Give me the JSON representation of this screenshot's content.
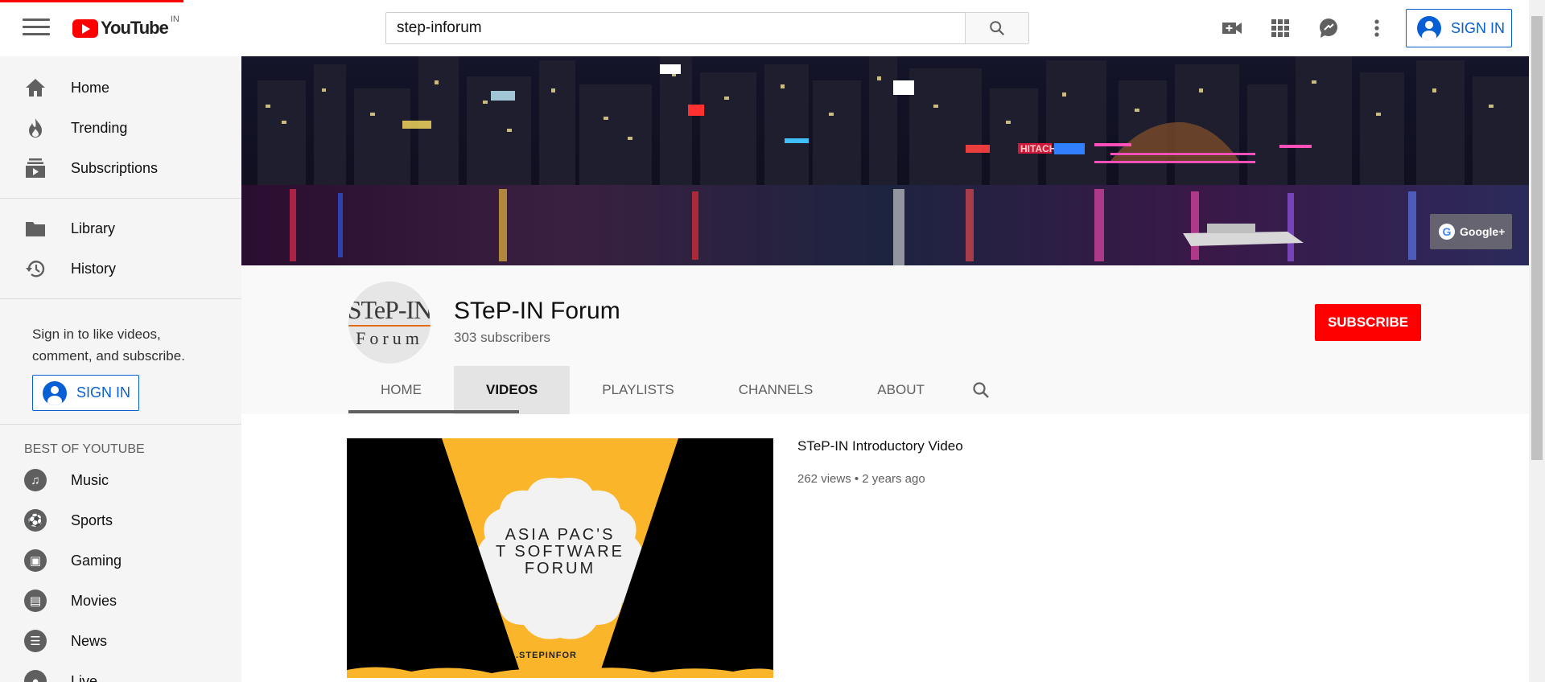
{
  "header": {
    "logo_text": "YouTube",
    "logo_country": "IN",
    "search_value": "step-inforum",
    "signin_label": "SIGN IN"
  },
  "sidebar": {
    "main": [
      {
        "label": "Home",
        "icon": "home-icon"
      },
      {
        "label": "Trending",
        "icon": "flame-icon"
      },
      {
        "label": "Subscriptions",
        "icon": "subscriptions-icon"
      }
    ],
    "library": [
      {
        "label": "Library",
        "icon": "folder-icon"
      },
      {
        "label": "History",
        "icon": "history-icon"
      }
    ],
    "signin_text": "Sign in to like videos, comment, and subscribe.",
    "signin_label": "SIGN IN",
    "best_of_title": "BEST OF YOUTUBE",
    "best_of": [
      {
        "label": "Music",
        "icon": "music-icon"
      },
      {
        "label": "Sports",
        "icon": "sports-icon"
      },
      {
        "label": "Gaming",
        "icon": "gaming-icon"
      },
      {
        "label": "Movies",
        "icon": "movies-icon"
      },
      {
        "label": "News",
        "icon": "news-icon"
      },
      {
        "label": "Live",
        "icon": "live-icon"
      }
    ]
  },
  "banner": {
    "social_link": "Google+",
    "sign_text": "HITACHI"
  },
  "channel": {
    "avatar_line1": "STeP-IN",
    "avatar_line2": "Forum",
    "name": "STeP-IN Forum",
    "subscribers": "303 subscribers",
    "subscribe_label": "SUBSCRIBE",
    "tabs": [
      "HOME",
      "VIDEOS",
      "PLAYLISTS",
      "CHANNELS",
      "ABOUT"
    ]
  },
  "video": {
    "title": "STeP-IN Introductory Video",
    "meta": "262 views • 2 years ago",
    "thumb_line1": "ASIA PAC'S",
    "thumb_line2": "T SOFTWARE",
    "thumb_line3": "FORUM",
    "thumb_url": ".STEPINFOR"
  },
  "colors": {
    "brand_red": "#ff0000",
    "link_blue": "#065fd4",
    "sidebar_bg": "#f5f5f5",
    "header_bg": "#f9f9f9",
    "thumb_orange": "#fbb52a"
  }
}
